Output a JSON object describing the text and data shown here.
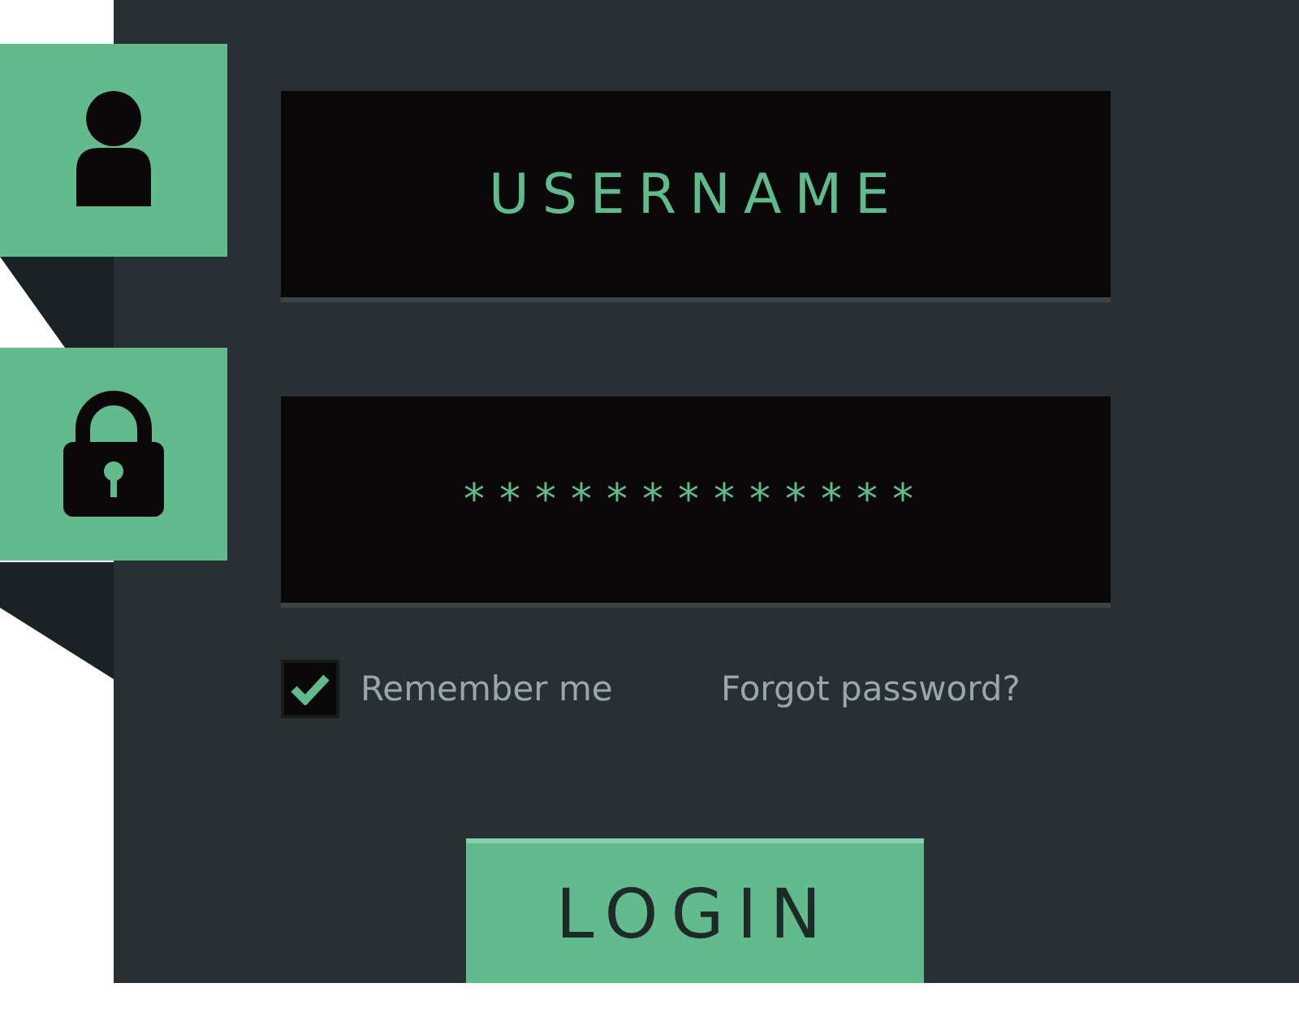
{
  "username": {
    "placeholder": "USERNAME"
  },
  "password": {
    "value": "*************"
  },
  "remember": {
    "label": "Remember me",
    "checked": true
  },
  "forgot_link": "Forgot password?",
  "login_button": "LOGIN"
}
